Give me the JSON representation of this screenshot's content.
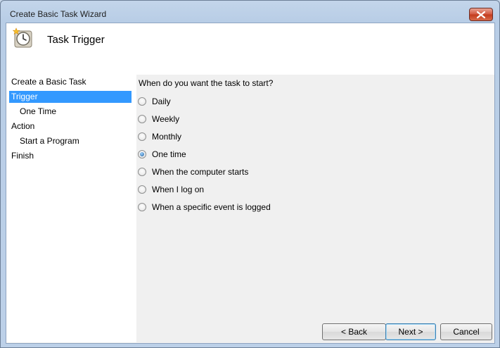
{
  "window": {
    "title": "Create Basic Task Wizard"
  },
  "header": {
    "title": "Task Trigger",
    "icon": "clock-icon"
  },
  "nav": {
    "items": [
      {
        "label": "Create a Basic Task",
        "level": 0,
        "selected": false
      },
      {
        "label": "Trigger",
        "level": 0,
        "selected": true
      },
      {
        "label": "One Time",
        "level": 1,
        "selected": false
      },
      {
        "label": "Action",
        "level": 0,
        "selected": false
      },
      {
        "label": "Start a Program",
        "level": 1,
        "selected": false
      },
      {
        "label": "Finish",
        "level": 0,
        "selected": false
      }
    ]
  },
  "main": {
    "question": "When do you want the task to start?",
    "options": [
      {
        "label": "Daily",
        "checked": false
      },
      {
        "label": "Weekly",
        "checked": false
      },
      {
        "label": "Monthly",
        "checked": false
      },
      {
        "label": "One time",
        "checked": true
      },
      {
        "label": "When the computer starts",
        "checked": false
      },
      {
        "label": "When I log on",
        "checked": false
      },
      {
        "label": "When a specific event is logged",
        "checked": false
      }
    ]
  },
  "buttons": {
    "back": "< Back",
    "next": "Next >",
    "cancel": "Cancel"
  },
  "colors": {
    "selection": "#3399ff",
    "close": "#c23a1c",
    "titlebar": "#bcd0e8"
  }
}
